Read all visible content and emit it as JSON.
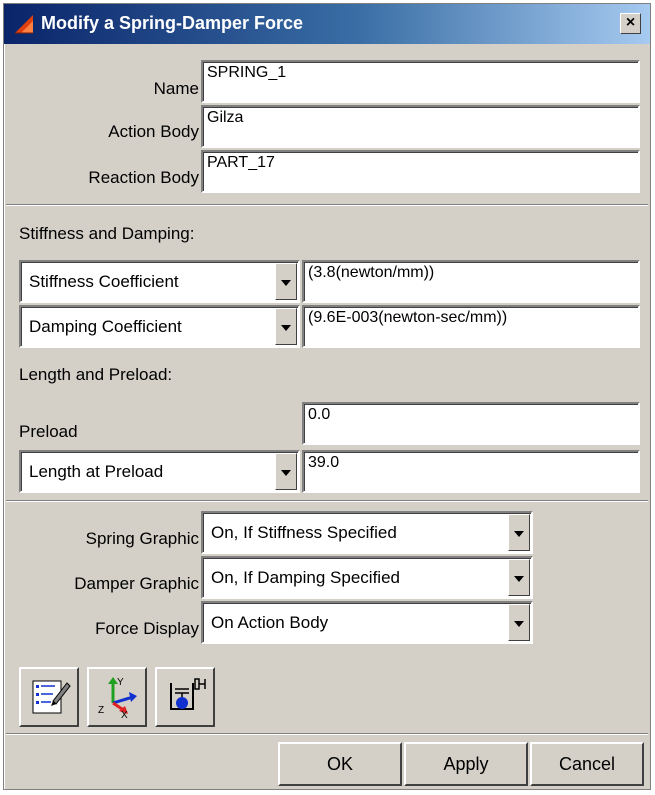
{
  "window": {
    "title": "Modify a Spring-Damper Force",
    "close_glyph": "×"
  },
  "fields": {
    "name_label": "Name",
    "name_value": "SPRING_1",
    "action_label": "Action Body",
    "action_value": "Gilza",
    "reaction_label": "Reaction Body",
    "reaction_value": "PART_17"
  },
  "stiffness": {
    "section_label": "Stiffness and Damping:",
    "stiffness_select": "Stiffness Coefficient",
    "stiffness_value": "(3.8(newton/mm))",
    "damping_select": "Damping Coefficient",
    "damping_value": "(9.6E-003(newton-sec/mm))"
  },
  "length": {
    "section_label": "Length and Preload:",
    "preload_label": "Preload",
    "preload_value": "0.0",
    "length_select": "Length at Preload",
    "length_value": "39.0"
  },
  "graphics": {
    "spring_label": "Spring Graphic",
    "spring_value": "On, If Stiffness Specified",
    "damper_label": "Damper Graphic",
    "damper_value": "On, If Damping Specified",
    "force_label": "Force Display",
    "force_value": "On Action Body"
  },
  "toolbar_icons": [
    "edit-properties-icon",
    "axes-xyz-icon",
    "spring-damper-icon"
  ],
  "buttons": {
    "ok": "OK",
    "apply": "Apply",
    "cancel": "Cancel"
  },
  "colors": {
    "title_start": "#0a246a",
    "title_end": "#a6caf0",
    "face": "#d4d0c8"
  }
}
